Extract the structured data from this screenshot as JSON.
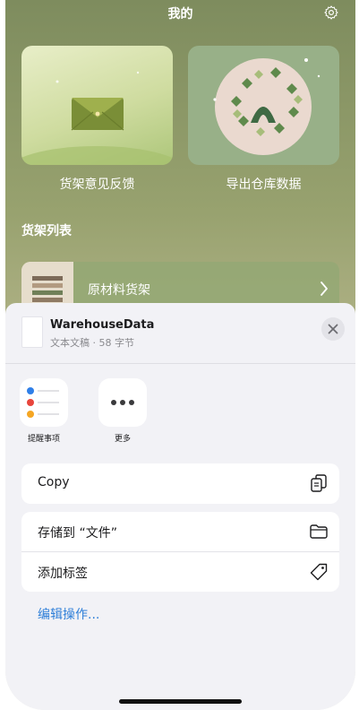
{
  "header": {
    "title": "我的",
    "settings_icon": "gear-icon"
  },
  "cards": [
    {
      "label": "货架意见反馈",
      "icon": "envelope-icon"
    },
    {
      "label": "导出仓库数据",
      "icon": "wreath-illustration"
    }
  ],
  "shelf_section": {
    "title": "货架列表",
    "items": [
      {
        "label": "原材料货架"
      }
    ]
  },
  "share_sheet": {
    "file_name": "WarehouseData",
    "file_meta": "文本文稿 · 58 字节",
    "close_icon": "close-icon",
    "apps": [
      {
        "label": "提醒事项",
        "icon": "reminders-icon"
      },
      {
        "label": "更多",
        "icon": "more-icon"
      }
    ],
    "actions_primary": [
      {
        "label": "Copy",
        "icon": "copy-icon"
      }
    ],
    "actions_secondary": [
      {
        "label": "存储到 “文件”",
        "icon": "folder-icon"
      },
      {
        "label": "添加标签",
        "icon": "tag-icon"
      }
    ],
    "edit_actions": "编辑操作..."
  },
  "colors": {
    "link": "#2f7fd8",
    "sheet_bg": "#f2f2f6"
  }
}
